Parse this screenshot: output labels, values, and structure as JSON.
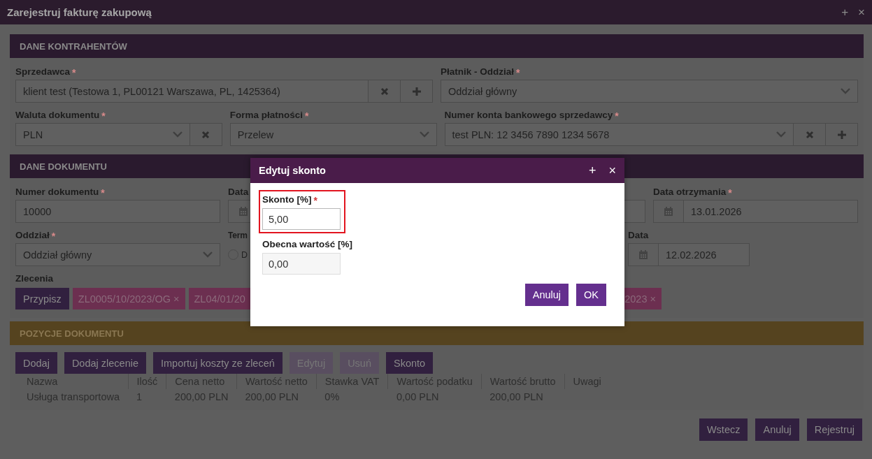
{
  "window": {
    "title": "Zarejestruj fakturę zakupową",
    "controls": [
      "+",
      "×"
    ]
  },
  "contractors": {
    "title": "DANE KONTRAHENTÓW",
    "fields": [
      {
        "label": "Sprzedawca",
        "mark": "*",
        "kind": "text",
        "value": "klient test (Testowa 1, PL00121 Warszawa, PL, 1425364)",
        "clear": true,
        "add": true
      },
      {
        "label": "Płatnik - Oddział",
        "mark": "*",
        "kind": "select",
        "value": "Oddział główny",
        "clear": false,
        "add": false
      },
      {
        "label": "Waluta dokumentu",
        "mark": "*",
        "kind": "select",
        "value": "PLN",
        "clear": true,
        "add": false
      },
      {
        "label": "Forma płatności",
        "mark": "*",
        "kind": "select",
        "value": "Przelew",
        "clear": false,
        "add": false
      },
      {
        "label": "Numer konta bankowego sprzedawcy",
        "mark": "*",
        "kind": "select",
        "value": "test PLN: 12 3456 7890 1234 5678",
        "clear": true,
        "add": true
      }
    ]
  },
  "document": {
    "title": "DANE DOKUMENTU",
    "fields": [
      {
        "label": "Numer dokumentu",
        "mark": "*",
        "kind": "text",
        "value": "10000"
      },
      {
        "label": "Data",
        "kind": "date"
      },
      {
        "kind": "text"
      },
      {
        "label": "Data otrzymania",
        "mark": "*",
        "kind": "date",
        "value": "13.01.2026"
      },
      {
        "label": "Oddział",
        "mark": "*",
        "kind": "select",
        "value": "Oddział główny"
      },
      {
        "label": "Term",
        "kind": "radio",
        "option": "D",
        "selected": false
      },
      {
        "label": "Data",
        "kind": "date",
        "value": "12.02.2026"
      }
    ],
    "orders": {
      "label": "Zlecenia",
      "assign": "Przypisz",
      "chips": [
        {
          "label": "ZL0005/10/2023/OG",
          "remove": "×"
        },
        {
          "label": "ZL04/01/20"
        },
        {
          "label": "2023",
          "remove": "×"
        }
      ]
    }
  },
  "positions": {
    "title": "POZYCJE DOKUMENTU",
    "buttons": [
      {
        "label": "Dodaj",
        "disabled": false
      },
      {
        "label": "Dodaj zlecenie",
        "disabled": false
      },
      {
        "label": "Importuj koszty ze zleceń",
        "disabled": false
      },
      {
        "label": "Edytuj",
        "disabled": true
      },
      {
        "label": "Usuń",
        "disabled": true
      },
      {
        "label": "Skonto",
        "disabled": false
      }
    ],
    "columns": [
      "Nazwa",
      "Ilość",
      "Cena netto",
      "Wartość netto",
      "Stawka VAT",
      "Wartość podatku",
      "Wartość brutto",
      "Uwagi"
    ],
    "rows": [
      [
        "Usługa transportowa",
        "1",
        "200,00 PLN",
        "200,00 PLN",
        "0%",
        "0,00 PLN",
        "200,00 PLN"
      ]
    ]
  },
  "footer": {
    "buttons": [
      "Wstecz",
      "Anuluj",
      "Rejestruj"
    ]
  },
  "dialog": {
    "title": "Edytuj skonto",
    "controls": [
      "+",
      "×"
    ],
    "fields": [
      {
        "label": "Skonto [%]",
        "mark": "*",
        "value": "5,00",
        "highlighted": true,
        "readonly": false
      },
      {
        "label": "Obecna wartość [%]",
        "value": "0,00",
        "highlighted": false,
        "readonly": true
      }
    ],
    "buttons": [
      "Anuluj",
      "OK"
    ]
  }
}
